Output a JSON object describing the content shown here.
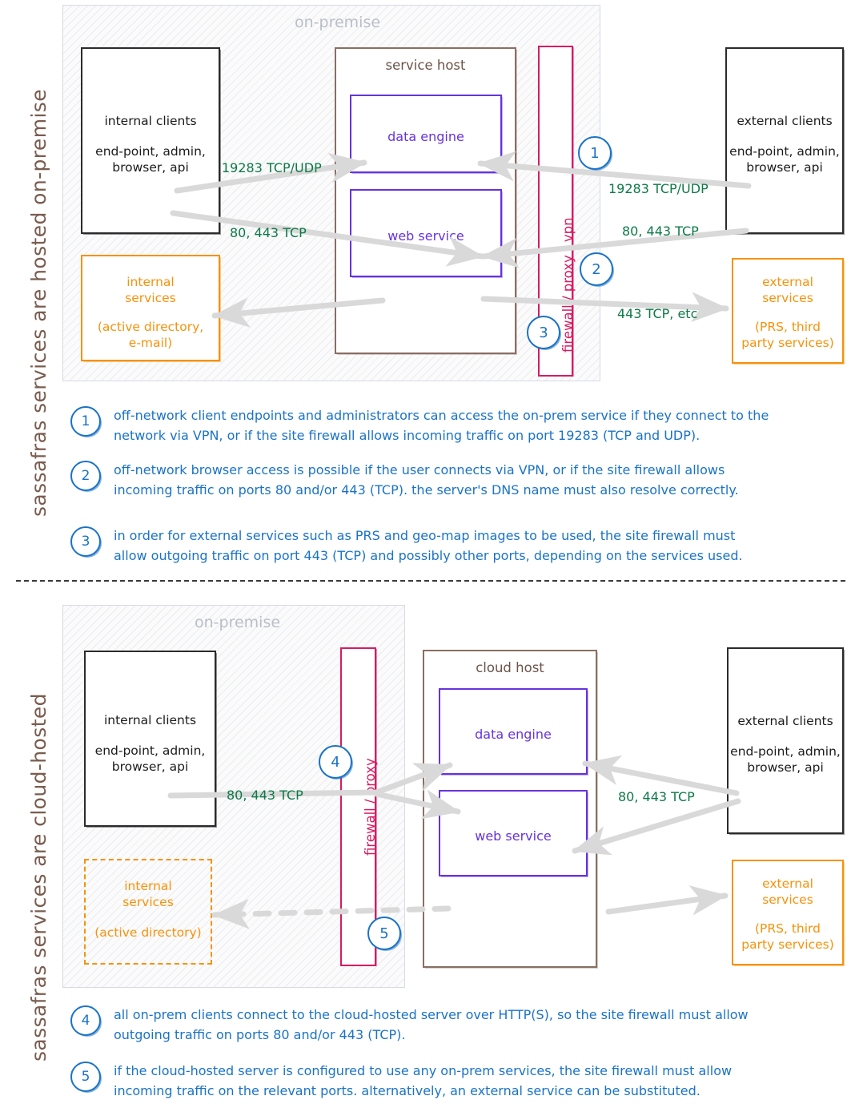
{
  "sections": [
    {
      "side_label": "sassafras services are hosted on-premise",
      "zone_title": "on-premise",
      "internal_clients": {
        "title": "internal clients",
        "detail": "end-point, admin,\nbrowser, api"
      },
      "internal_services": {
        "title": "internal\nservices",
        "detail": "(active directory,\ne-mail)"
      },
      "host": {
        "title": "service host",
        "data_engine": "data engine",
        "web_service": "web service"
      },
      "firewall": "firewall / proxy / vpn",
      "external_clients": {
        "title": "external clients",
        "detail": "end-point, admin,\nbrowser, api"
      },
      "external_services": {
        "title": "external\nservices",
        "detail": "(PRS, third\nparty services)"
      },
      "ports": {
        "internal_engine": "19283 TCP/UDP",
        "internal_web": "80, 443 TCP",
        "external_engine": "19283 TCP/UDP",
        "external_web": "80, 443 TCP",
        "external_services": "443 TCP, etc"
      },
      "markers": [
        "1",
        "2",
        "3"
      ],
      "notes": [
        {
          "num": "1",
          "text": "off-network client endpoints and administrators can access the on-prem service if they connect to the\nnetwork via VPN, or if the site firewall allows incoming traffic on port 19283 (TCP and UDP)."
        },
        {
          "num": "2",
          "text": "off-network browser access is possible if the user connects via VPN, or if the site firewall allows\nincoming traffic on ports 80 and/or 443 (TCP). the server's DNS name must also resolve correctly."
        },
        {
          "num": "3",
          "text": "in order for external services such as PRS and geo-map images to be used, the site firewall must\nallow outgoing traffic on port 443 (TCP) and possibly other ports, depending on the services used."
        }
      ]
    },
    {
      "side_label": "sassafras services are cloud-hosted",
      "zone_title": "on-premise",
      "internal_clients": {
        "title": "internal clients",
        "detail": "end-point, admin,\nbrowser, api"
      },
      "internal_services": {
        "title": "internal\nservices",
        "detail": "(active directory)"
      },
      "host": {
        "title": "cloud host",
        "data_engine": "data engine",
        "web_service": "web service"
      },
      "firewall": "firewall / proxy",
      "external_clients": {
        "title": "external clients",
        "detail": "end-point, admin,\nbrowser, api"
      },
      "external_services": {
        "title": "external\nservices",
        "detail": "(PRS, third\nparty services)"
      },
      "ports": {
        "internal_web": "80, 443 TCP",
        "external_web": "80, 443 TCP"
      },
      "markers": [
        "4",
        "5"
      ],
      "notes": [
        {
          "num": "4",
          "text": "all on-prem clients connect to the cloud-hosted server over HTTP(S), so the site firewall must allow\noutgoing traffic on ports 80 and/or 443 (TCP)."
        },
        {
          "num": "5",
          "text": "if the cloud-hosted server is configured to use any on-prem services, the site firewall must allow\nincoming traffic on the relevant ports. alternatively, an external service can be substituted."
        }
      ]
    }
  ],
  "colors": {
    "ink_black": "#1b1b1b",
    "orange": "#f6920b",
    "purple": "#6633dd",
    "host_brown": "#8a6f63",
    "firewall_pink": "#d81b60",
    "green": "#0d7a47",
    "blue": "#1a73c7",
    "zone_gray": "#b9bec7",
    "label_brown": "#7a5c4f"
  }
}
